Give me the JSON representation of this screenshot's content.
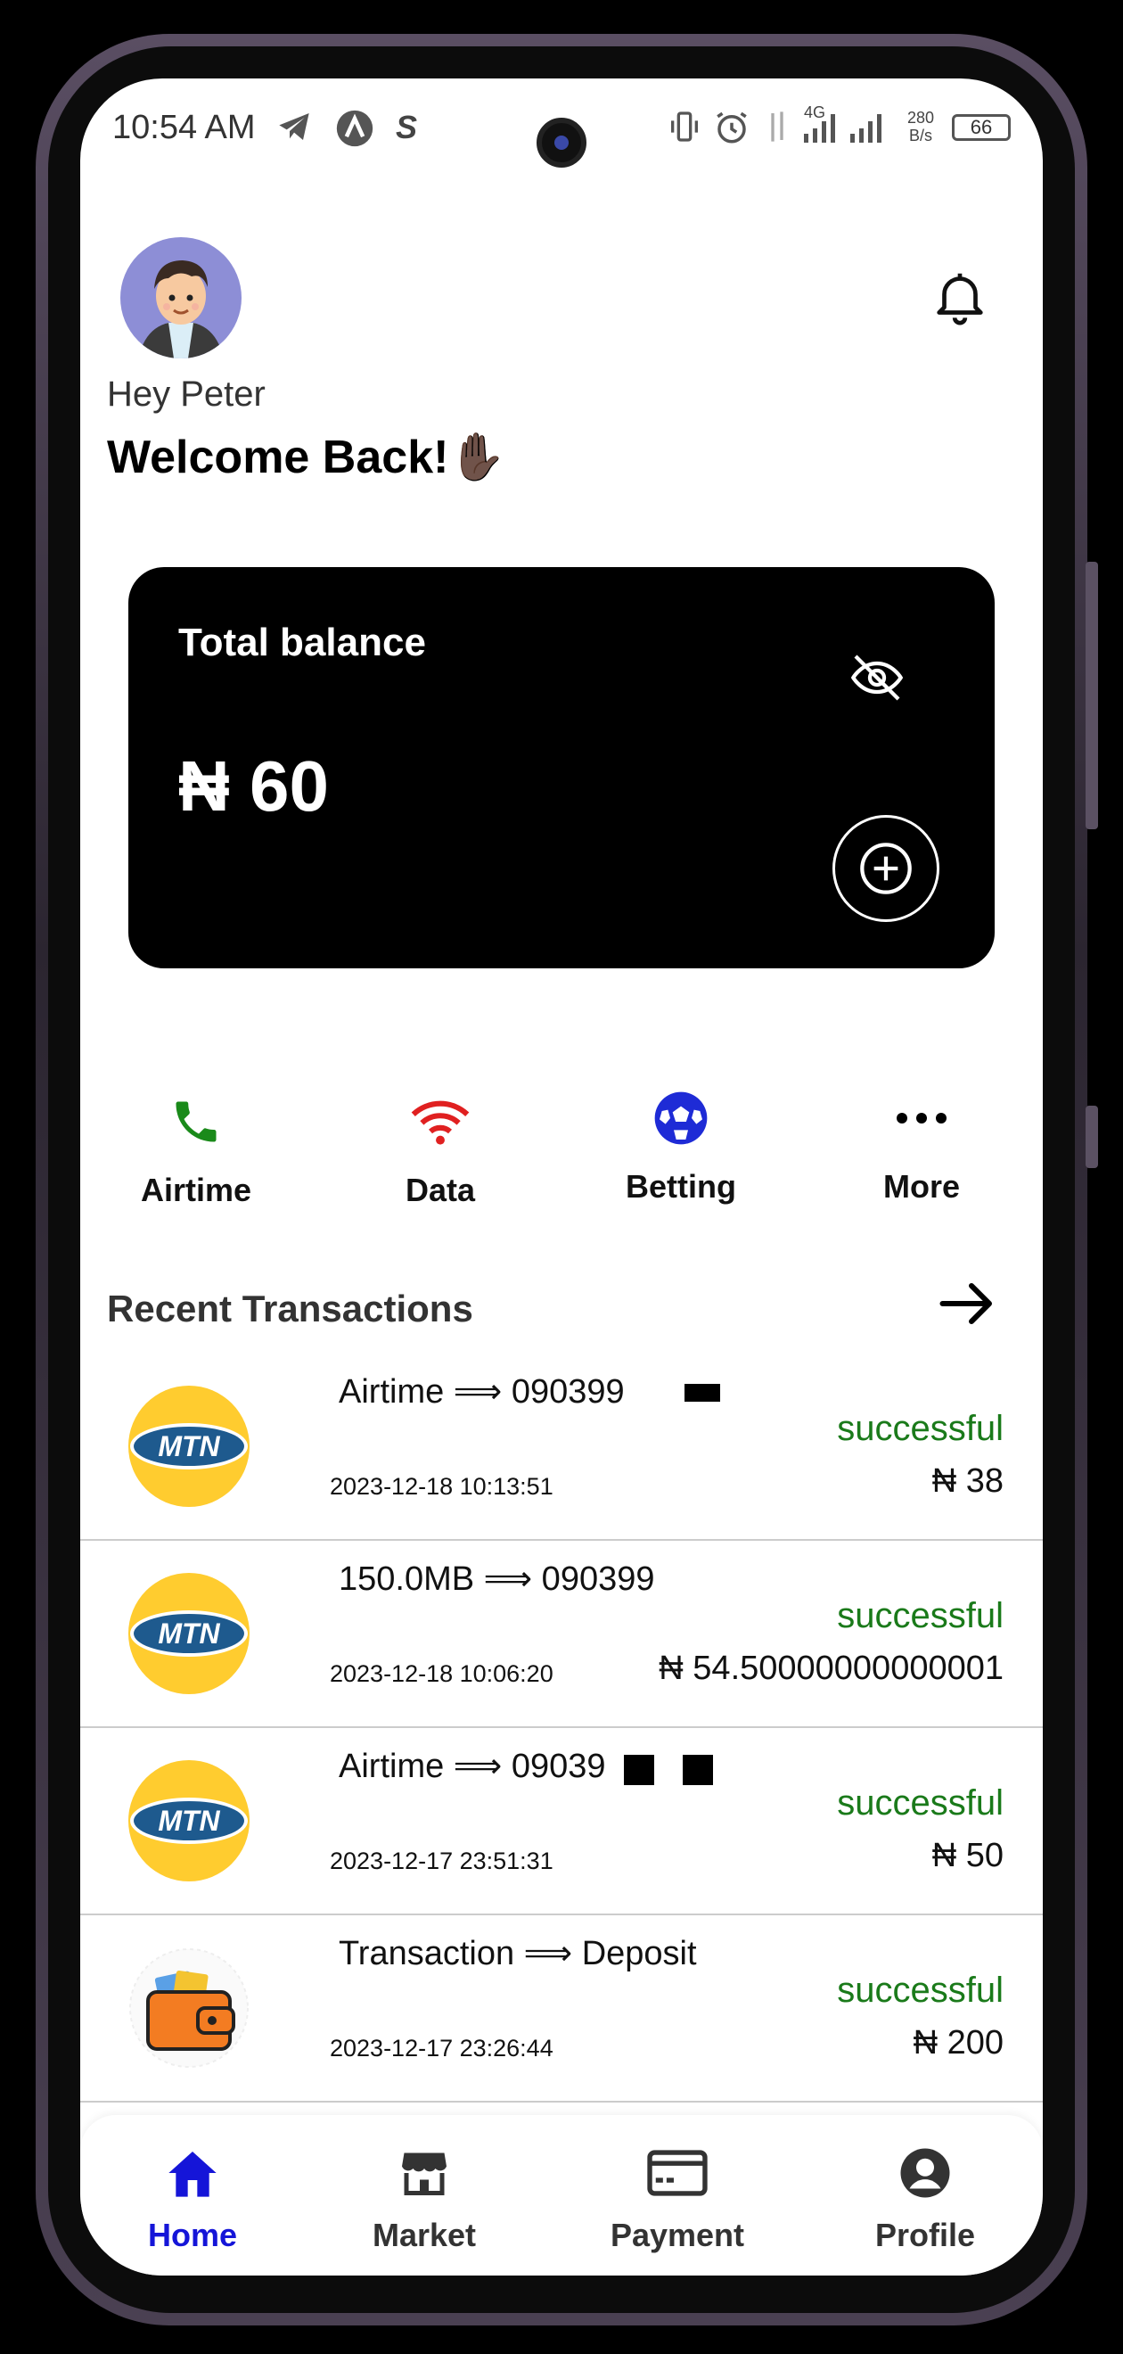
{
  "status_bar": {
    "time": "10:54 AM",
    "network": "4G",
    "speed_top": "280",
    "speed_bottom": "B/s",
    "battery": "66"
  },
  "header": {
    "greeting": "Hey Peter",
    "welcome": "Welcome Back!✋🏿"
  },
  "balance": {
    "title": "Total balance",
    "amount": "₦ 60"
  },
  "quick_actions": [
    {
      "label": "Airtime",
      "icon": "phone-icon",
      "color": "#1a8a1a"
    },
    {
      "label": "Data",
      "icon": "wifi-icon",
      "color": "#e02020"
    },
    {
      "label": "Betting",
      "icon": "soccer-ball-icon",
      "color": "#1e2bd6"
    },
    {
      "label": "More",
      "icon": "more-dots-icon",
      "color": "#000000"
    }
  ],
  "recent": {
    "title": "Recent Transactions",
    "items": [
      {
        "desc": "Airtime ⟹ 090399",
        "date": "2023-12-18 10:13:51",
        "status": "successful",
        "amount": "₦ 38",
        "logo": "mtn-logo"
      },
      {
        "desc": "150.0MB ⟹ 090399",
        "date": "2023-12-18 10:06:20",
        "status": "successful",
        "amount": "₦ 54.50000000000001",
        "logo": "mtn-logo"
      },
      {
        "desc": "Airtime ⟹ 09039",
        "date": "2023-12-17 23:51:31",
        "status": "successful",
        "amount": "₦ 50",
        "logo": "mtn-logo"
      },
      {
        "desc": "Transaction ⟹ Deposit",
        "date": "2023-12-17 23:26:44",
        "status": "successful",
        "amount": "₦ 200",
        "logo": "wallet-logo"
      }
    ]
  },
  "nav": [
    {
      "label": "Home",
      "icon": "home-icon",
      "active": true
    },
    {
      "label": "Market",
      "icon": "store-icon",
      "active": false
    },
    {
      "label": "Payment",
      "icon": "card-icon",
      "active": false
    },
    {
      "label": "Profile",
      "icon": "profile-icon",
      "active": false
    }
  ],
  "colors": {
    "accent": "#1515d8",
    "success": "#1a7a1a",
    "card_bg": "#000000"
  }
}
